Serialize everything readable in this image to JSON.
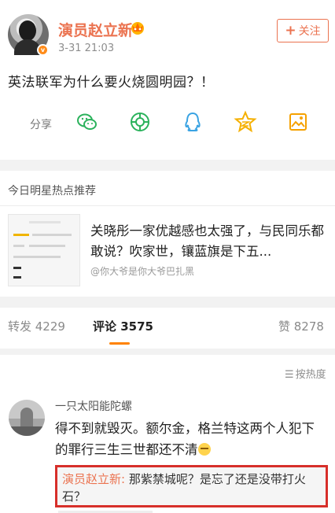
{
  "post": {
    "author": "演员赵立新",
    "timestamp": "3-31 21:03",
    "follow_label": "关注",
    "follow_plus": "+",
    "verified_icon": "v-badge-icon",
    "text": "英法联军为什么要火烧圆明园？！",
    "actions": {
      "share_label": "分享",
      "icons": [
        "wechat-icon",
        "moments-icon",
        "qq-icon",
        "qzone-icon",
        "save-image-icon"
      ]
    }
  },
  "hot": {
    "section_title": "今日明星热点推荐",
    "headline": "关晓彤一家优越感也太强了，与民同乐都敢说？吹家世，镶蓝旗是下五...",
    "source": "@你大爷是你大爷巴扎黑"
  },
  "tabs": {
    "repost": "转发 4229",
    "comment": "评论 3575",
    "like": "赞 8278",
    "active_color": "#ff8200"
  },
  "comments": {
    "sort_label": "按热度",
    "items": [
      {
        "username": "一只太阳能陀螺",
        "text": "得不到就毁灭。额尔金，格兰特这两个人犯下的罪行三生三世都还不清",
        "emoji": "sweat-emoji",
        "reply": {
          "author": "演员赵立新:",
          "text": " 那紫禁城呢？是忘了还是没带打火石？",
          "highlight_color": "#d72f2a"
        }
      }
    ]
  },
  "colors": {
    "brand_orange": "#eb7350",
    "tab_accent": "#ff8200",
    "highlight_red": "#d72f2a"
  }
}
